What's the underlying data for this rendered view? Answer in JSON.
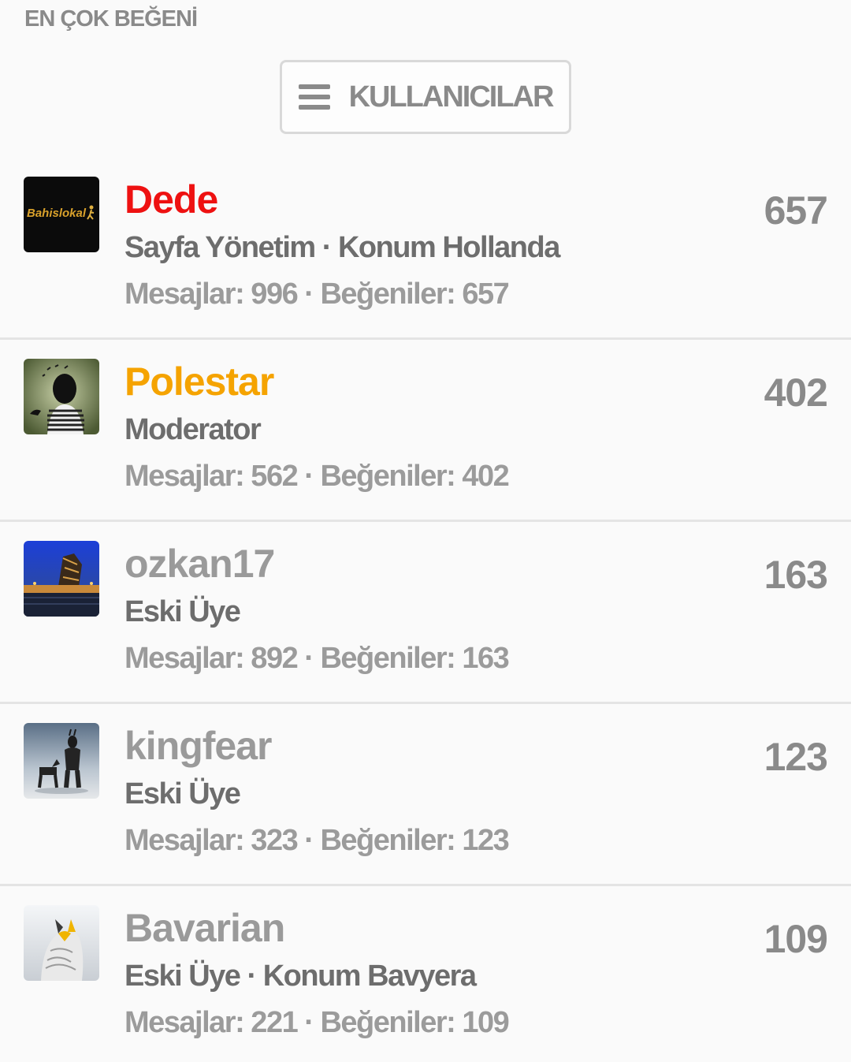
{
  "section_title": "EN ÇOK BEĞENİ",
  "users_button": {
    "label": "KULLANICILAR",
    "icon": "menu-icon"
  },
  "members": [
    {
      "name": "Dede",
      "name_color": "#ee1111",
      "avatar_label": "Bahislokal",
      "meta": "Sayfa Yönetim · Konum Hollanda",
      "stats": "Mesajlar: 996 · Beğeniler: 657",
      "score": "657"
    },
    {
      "name": "Polestar",
      "name_color": "#f5a300",
      "meta": "Moderator",
      "stats": "Mesajlar: 562 · Beğeniler: 402",
      "score": "402"
    },
    {
      "name": "ozkan17",
      "name_color": "#9a9a9a",
      "meta": "Eski Üye",
      "stats": "Mesajlar: 892 · Beğeniler: 163",
      "score": "163"
    },
    {
      "name": "kingfear",
      "name_color": "#9a9a9a",
      "meta": "Eski Üye",
      "stats": "Mesajlar: 323 · Beğeniler: 123",
      "score": "123"
    },
    {
      "name": "Bavarian",
      "name_color": "#9a9a9a",
      "meta": "Eski Üye · Konum Bavyera",
      "stats": "Mesajlar: 221 · Beğeniler: 109",
      "score": "109"
    }
  ]
}
